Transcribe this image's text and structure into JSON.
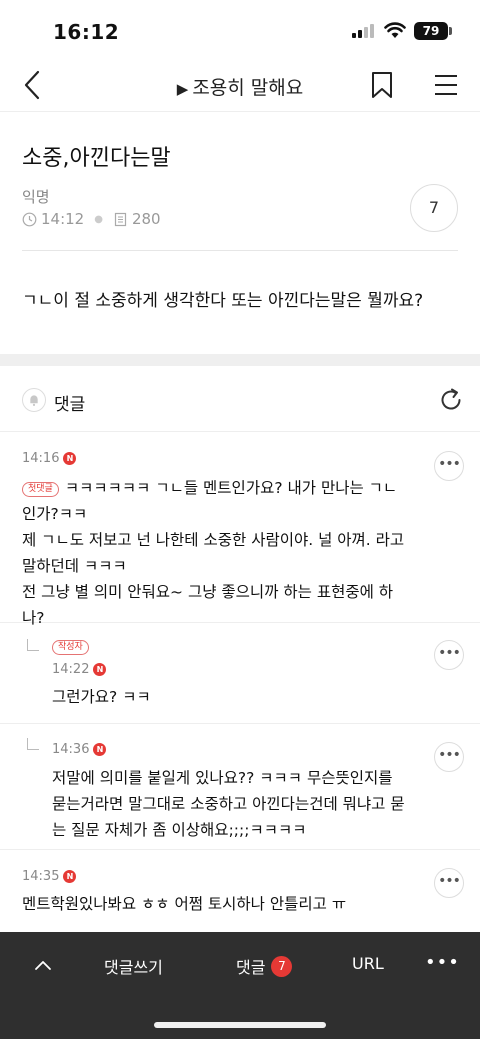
{
  "status": {
    "time": "16:12",
    "battery": "79"
  },
  "nav": {
    "title": "조용히 말해요",
    "play_icon": "▶"
  },
  "post": {
    "title": "소중,아낀다는말",
    "author": "익명",
    "time": "14:12",
    "views": "280",
    "comment_count": "7",
    "body": "ㄱㄴ이 절 소중하게 생각한다 또는 아낀다는말은 뭘까요?"
  },
  "comments_header": {
    "title": "댓글"
  },
  "comments": [
    {
      "time": "14:16",
      "badge": "N",
      "tag": "첫댓글",
      "lines": [
        "ㅋㅋㅋㅋㅋㅋ ㄱㄴ들 멘트인가요? 내가 만나는 ㄱㄴ",
        "인가?ㅋㅋ",
        "제 ㄱㄴ도 저보고 넌 나한테 소중한 사람이야. 널 아껴. 라고",
        "말하던데 ㅋㅋㅋ",
        "전 그냥 별 의미 안둬요~ 그냥 좋으니까 하는 표현중에 하",
        "나?"
      ]
    },
    {
      "time": "14:22",
      "badge": "N",
      "tag": "작성자",
      "lines": [
        "그런가요? ㅋㅋ"
      ]
    },
    {
      "time": "14:36",
      "badge": "N",
      "lines": [
        "저말에 의미를 붙일게 있나요?? ㅋㅋㅋ 무슨뜻인지를",
        "묻는거라면 말그대로 소중하고 아낀다는건데 뭐냐고 묻",
        "는 질문 자체가 좀 이상해요;;;;ㅋㅋㅋㅋ"
      ]
    },
    {
      "time": "14:35",
      "badge": "N",
      "lines": [
        "멘트학원있나봐요 ㅎㅎ 어쩜 토시하나 안틀리고 ㅠ"
      ]
    }
  ],
  "bottom_bar": {
    "write_label": "댓글쓰기",
    "comment_label": "댓글",
    "comment_count": "7",
    "url_label": "URL",
    "more_label": "•••"
  },
  "more_button_label": "•••"
}
